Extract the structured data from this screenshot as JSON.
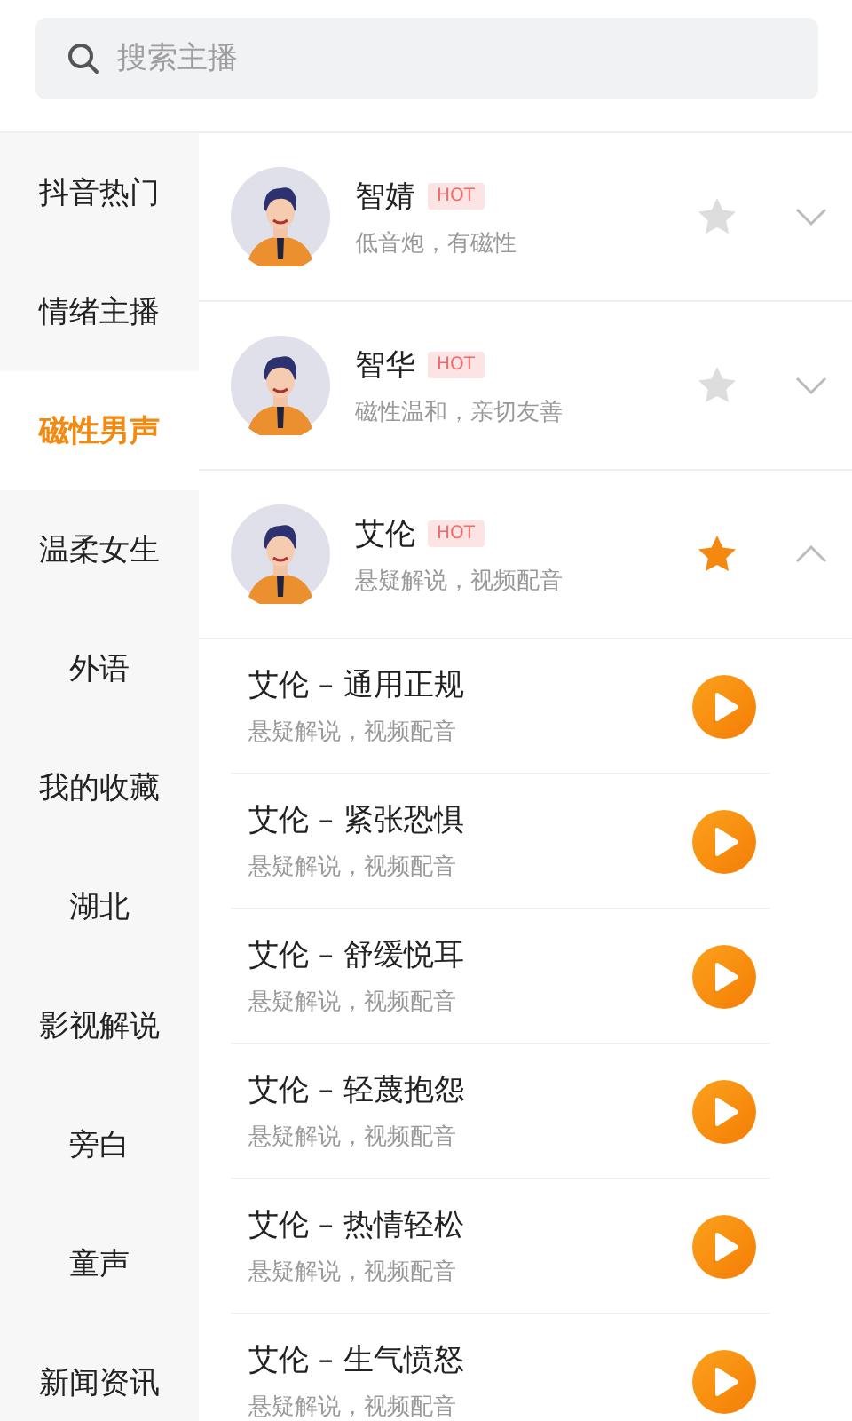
{
  "search": {
    "placeholder": "搜索主播"
  },
  "categories": [
    {
      "label": "抖音热门",
      "selected": false
    },
    {
      "label": "情绪主播",
      "selected": false
    },
    {
      "label": "磁性男声",
      "selected": true
    },
    {
      "label": "温柔女生",
      "selected": false
    },
    {
      "label": "外语",
      "selected": false
    },
    {
      "label": "我的收藏",
      "selected": false
    },
    {
      "label": "湖北",
      "selected": false
    },
    {
      "label": "影视解说",
      "selected": false
    },
    {
      "label": "旁白",
      "selected": false
    },
    {
      "label": "童声",
      "selected": false
    },
    {
      "label": "新闻资讯",
      "selected": false
    }
  ],
  "anchors": [
    {
      "name": "智婧",
      "badge": "HOT",
      "description": "低音炮，有磁性",
      "favorite": false,
      "expanded": false
    },
    {
      "name": "智华",
      "badge": "HOT",
      "description": "磁性温和，亲切友善",
      "favorite": false,
      "expanded": false
    },
    {
      "name": "艾伦",
      "badge": "HOT",
      "description": "悬疑解说，视频配音",
      "favorite": true,
      "expanded": true,
      "tracks": [
        {
          "title": "艾伦 – 通用正规",
          "description": "悬疑解说，视频配音"
        },
        {
          "title": "艾伦 – 紧张恐惧",
          "description": "悬疑解说，视频配音"
        },
        {
          "title": "艾伦 – 舒缓悦耳",
          "description": "悬疑解说，视频配音"
        },
        {
          "title": "艾伦 – 轻蔑抱怨",
          "description": "悬疑解说，视频配音"
        },
        {
          "title": "艾伦 – 热情轻松",
          "description": "悬疑解说，视频配音"
        },
        {
          "title": "艾伦 – 生气愤怒",
          "description": "悬疑解说，视频配音"
        }
      ]
    }
  ]
}
